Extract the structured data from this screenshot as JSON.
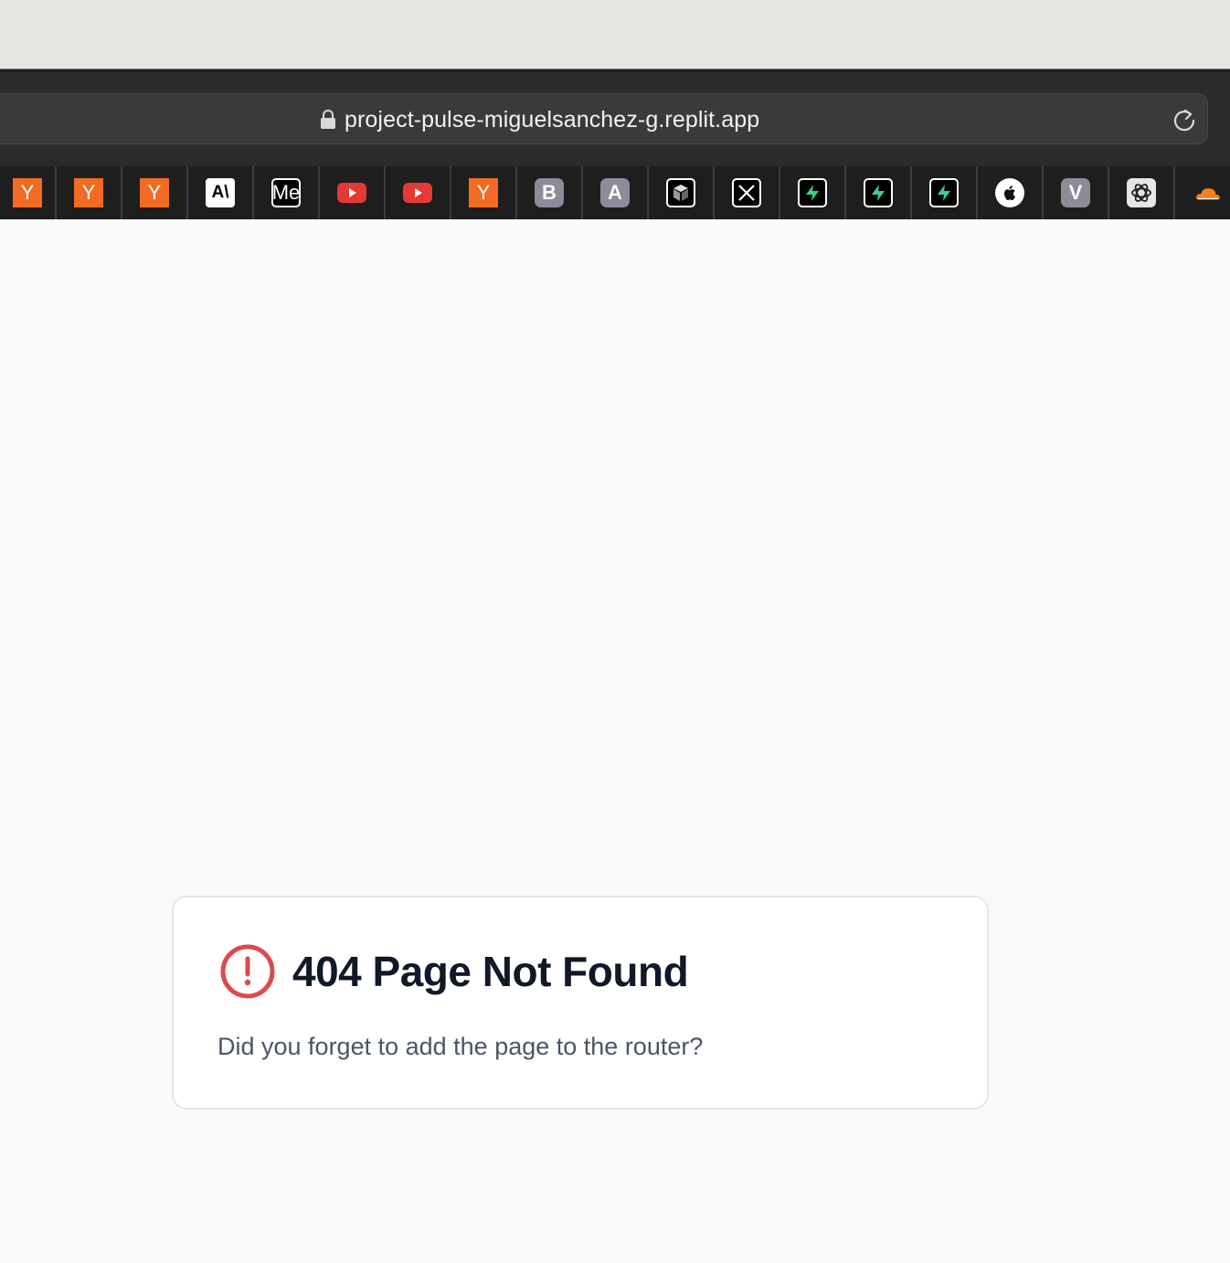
{
  "browser": {
    "url": "project-pulse-miguelsanchez-g.replit.app"
  },
  "bookmarks": [
    {
      "icon": "y-combinator-icon",
      "glyph": "Y",
      "style": "fav-y"
    },
    {
      "icon": "y-combinator-icon",
      "glyph": "Y",
      "style": "fav-y"
    },
    {
      "icon": "y-combinator-icon",
      "glyph": "Y",
      "style": "fav-y"
    },
    {
      "icon": "anthropic-icon",
      "glyph": "A\\",
      "style": "fav-white"
    },
    {
      "icon": "medium-icon",
      "glyph": "Me",
      "style": "fav-outline"
    },
    {
      "icon": "youtube-icon",
      "glyph": "",
      "style": "fav-yt"
    },
    {
      "icon": "youtube-icon",
      "glyph": "",
      "style": "fav-yt"
    },
    {
      "icon": "y-combinator-icon",
      "glyph": "Y",
      "style": "fav-y"
    },
    {
      "icon": "letter-b-icon",
      "glyph": "B",
      "style": "fav-grey"
    },
    {
      "icon": "letter-a-icon",
      "glyph": "A",
      "style": "fav-grey"
    },
    {
      "icon": "cube-icon",
      "glyph": "",
      "style": "fav-outline"
    },
    {
      "icon": "x-icon",
      "glyph": "",
      "style": "fav-outline"
    },
    {
      "icon": "supabase-icon",
      "glyph": "",
      "style": "fav-outline"
    },
    {
      "icon": "supabase-icon",
      "glyph": "",
      "style": "fav-outline"
    },
    {
      "icon": "supabase-icon",
      "glyph": "",
      "style": "fav-outline"
    },
    {
      "icon": "apple-icon",
      "glyph": "",
      "style": "fav-round"
    },
    {
      "icon": "letter-v-icon",
      "glyph": "V",
      "style": "fav-grey"
    },
    {
      "icon": "openai-icon",
      "glyph": "",
      "style": "fav-gpt"
    },
    {
      "icon": "cloudflare-icon",
      "glyph": "",
      "style": "fav-yt"
    }
  ],
  "error": {
    "title": "404 Page Not Found",
    "message": "Did you forget to add the page to the router?"
  },
  "colors": {
    "alert": "#dc4b4b",
    "title": "#111827",
    "message": "#4b5563",
    "background": "#f8f9fa"
  }
}
